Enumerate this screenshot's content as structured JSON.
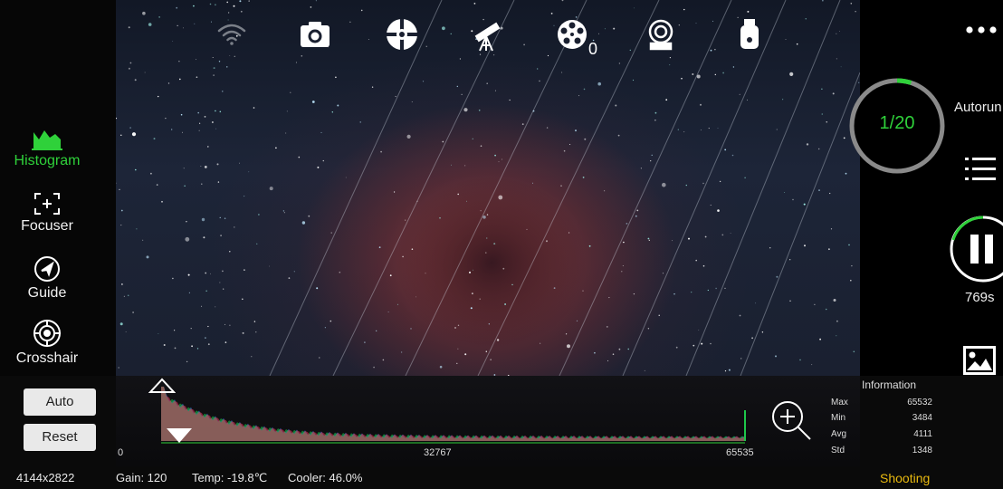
{
  "left_tools": [
    {
      "label": "Histogram",
      "icon": "histogram-icon",
      "active": true
    },
    {
      "label": "Focuser",
      "icon": "focuser-icon",
      "active": false
    },
    {
      "label": "Guide",
      "icon": "guide-icon",
      "active": false
    },
    {
      "label": "Crosshair",
      "icon": "crosshair-icon",
      "active": false
    }
  ],
  "top_icons": [
    "wifi-icon",
    "camera-icon",
    "mount-icon",
    "telescope-icon",
    "filter-wheel-icon",
    "focuser-device-icon",
    "usb-drive-icon"
  ],
  "filter_wheel_position": "0",
  "progress": {
    "label": "1/20",
    "current": 1,
    "total": 20
  },
  "right": {
    "autorun_label": "Autorun",
    "exposure_remaining": "769s"
  },
  "histogram": {
    "auto_label": "Auto",
    "reset_label": "Reset",
    "axis_min": "0",
    "axis_mid": "32767",
    "axis_max": "65535"
  },
  "information": {
    "title": "Information",
    "rows": [
      {
        "label": "Max",
        "value": "65532"
      },
      {
        "label": "Min",
        "value": "3484"
      },
      {
        "label": "Avg",
        "value": "4111"
      },
      {
        "label": "Std",
        "value": "1348"
      }
    ]
  },
  "status": {
    "resolution": "4144x2822",
    "gain": "Gain: 120",
    "temp": "Temp: -19.8℃",
    "cooler": "Cooler: 46.0%",
    "state": "Shooting"
  },
  "colors": {
    "accent": "#2fd13a",
    "state": "#e8b90f"
  }
}
